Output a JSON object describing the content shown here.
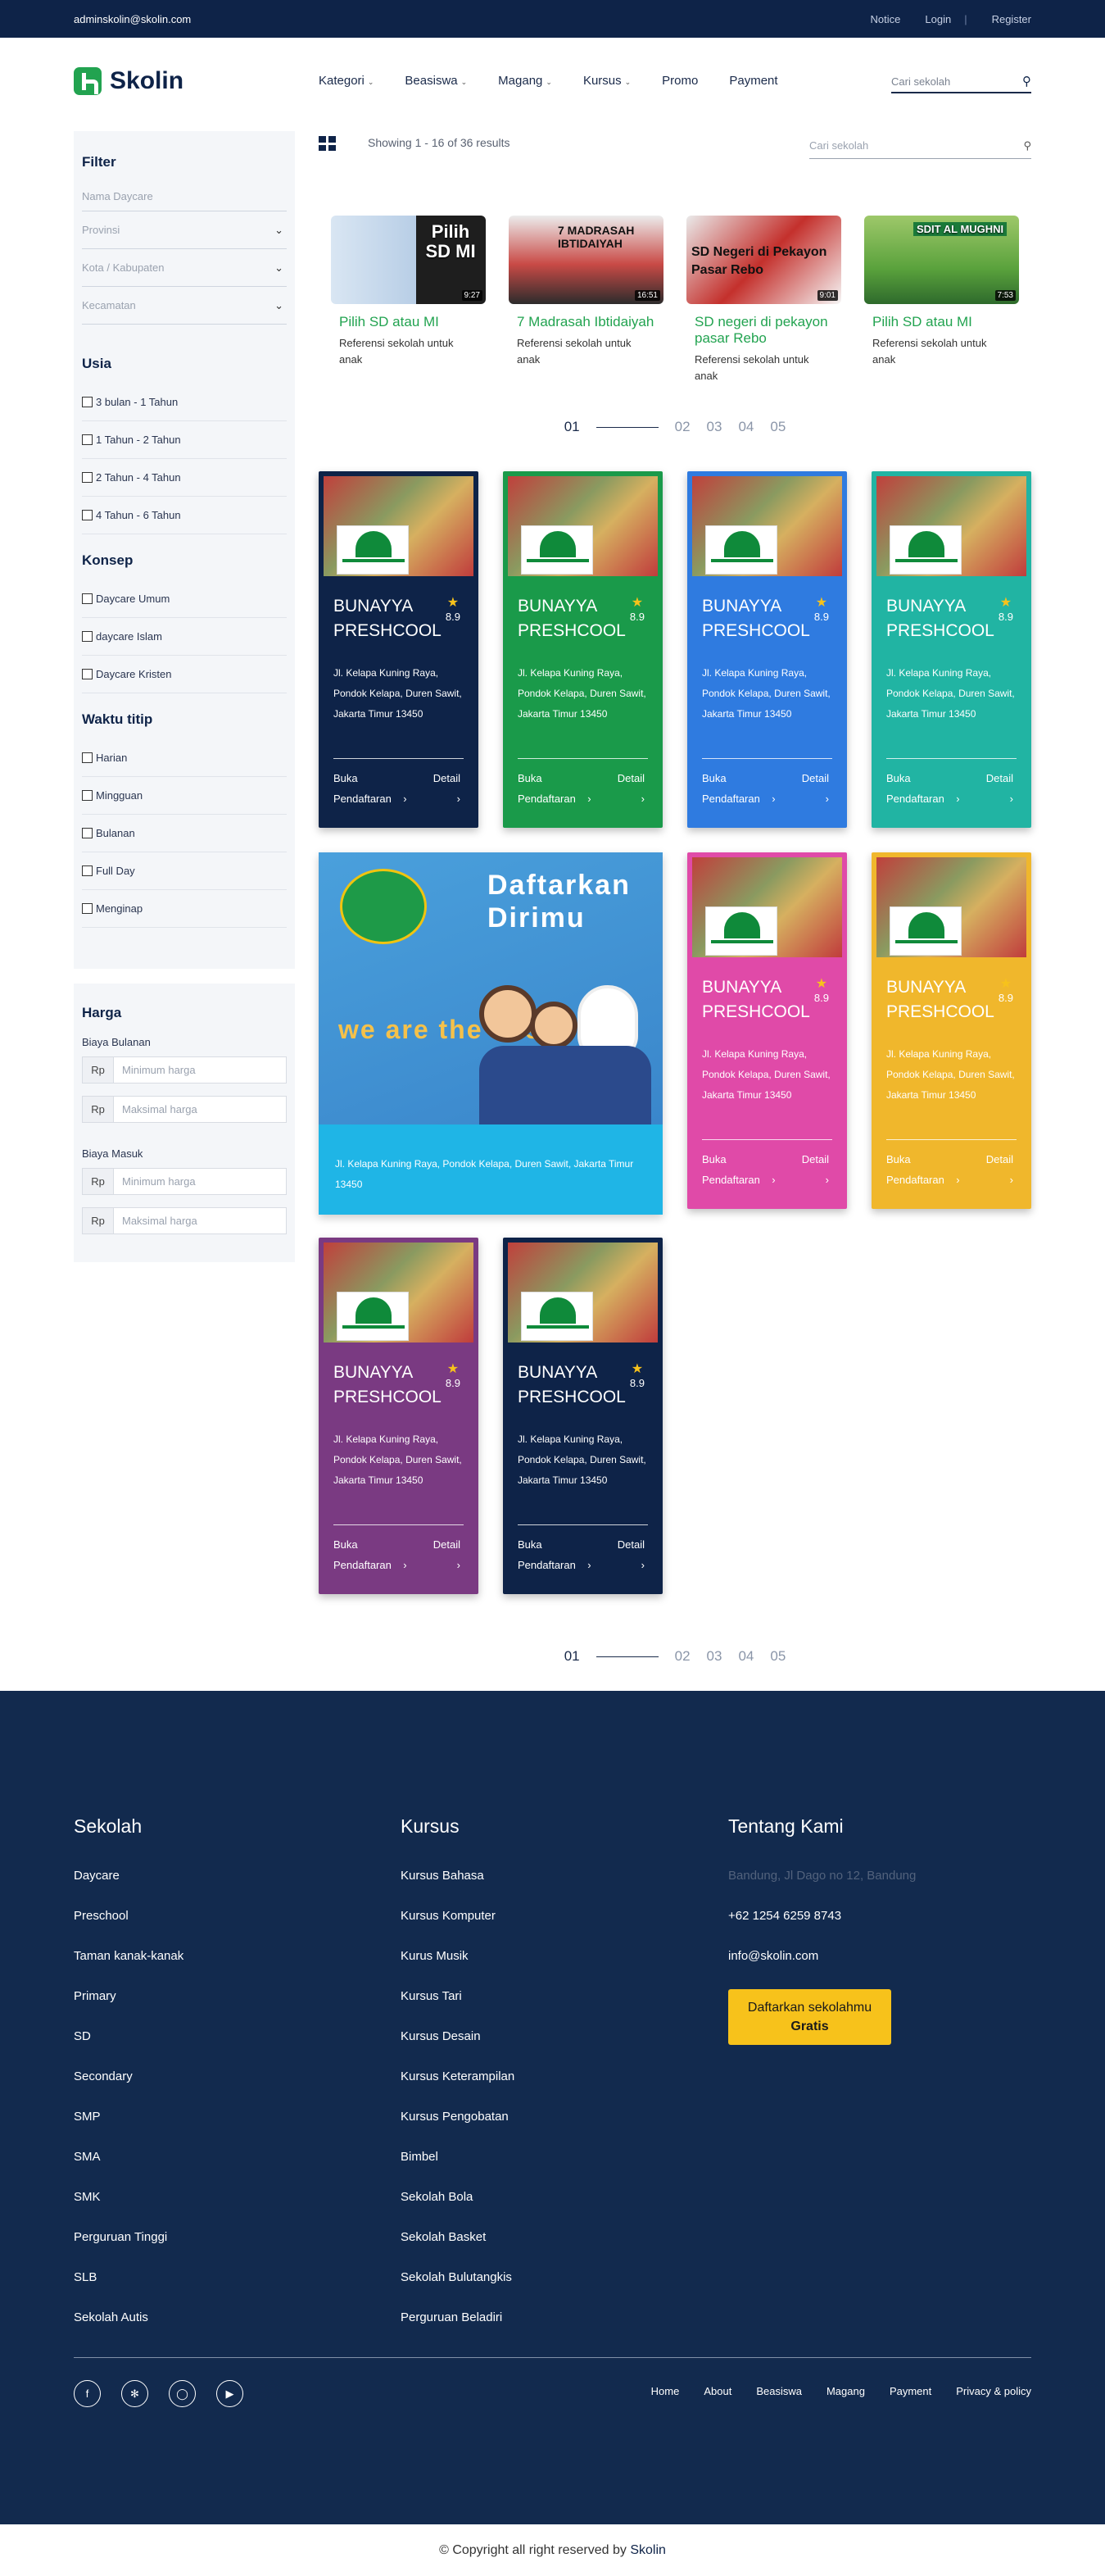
{
  "topbar": {
    "email": "adminskolin@skolin.com",
    "notice": "Notice",
    "login": "Login",
    "sep": "|",
    "register": "Register"
  },
  "brand": {
    "name": "Skolin",
    "color": "#22a350"
  },
  "nav": [
    {
      "label": "Kategori",
      "dropdown": true
    },
    {
      "label": "Beasiswa",
      "dropdown": true
    },
    {
      "label": "Magang",
      "dropdown": true
    },
    {
      "label": "Kursus",
      "dropdown": true
    },
    {
      "label": "Promo",
      "dropdown": false
    },
    {
      "label": "Payment",
      "dropdown": false
    }
  ],
  "header_search": {
    "placeholder": "Cari sekolah",
    "icon": "search-icon"
  },
  "filter": {
    "title": "Filter",
    "fields": [
      "Nama Daycare",
      "Provinsi",
      "Kota / Kabupaten",
      "Kecamatan"
    ],
    "usia": {
      "title": "Usia",
      "items": [
        "3 bulan - 1 Tahun",
        "1 Tahun - 2 Tahun",
        "2 Tahun - 4 Tahun",
        "4 Tahun - 6 Tahun"
      ]
    },
    "konsep": {
      "title": "Konsep",
      "items": [
        "Daycare Umum",
        "daycare Islam",
        "Daycare Kristen"
      ]
    },
    "waktu": {
      "title": "Waktu titip",
      "items": [
        "Harian",
        "Mingguan",
        "Bulanan",
        "Full Day",
        "Menginap"
      ]
    }
  },
  "harga": {
    "title": "Harga",
    "bulanan": "Biaya Bulanan",
    "masuk": "Biaya Masuk",
    "currency": "Rp",
    "min": "Minimum harga",
    "max": "Maksimal harga"
  },
  "results": {
    "text": "Showing 1 - 16 of 36 results",
    "search_placeholder": "Cari sekolah"
  },
  "videos": [
    {
      "title": "Pilih SD atau MI",
      "desc": "Referensi sekolah untuk anak",
      "thumb": "Pilih SD MI",
      "duration": "9:27"
    },
    {
      "title": "7 Madrasah Ibtidaiyah",
      "desc": "Referensi sekolah untuk anak",
      "thumb": "7 MADRASAH IBTIDAIYAH",
      "duration": "16:51"
    },
    {
      "title": "SD negeri di pekayon pasar Rebo",
      "desc": "Referensi sekolah untuk anak",
      "thumb": "SD Negeri di Pekayon Pasar Rebo",
      "duration": "9:01"
    },
    {
      "title": "Pilih SD atau MI",
      "desc": "Referensi sekolah untuk anak",
      "thumb": "SDIT AL MUGHNI",
      "duration": "7:53"
    }
  ],
  "pager": [
    "01",
    "02",
    "03",
    "04",
    "05"
  ],
  "school": {
    "name": "BUNAYYA PRESHCOOL",
    "rating": "8.9",
    "address": "Jl. Kelapa Kuning Raya, Pondok Kelapa, Duren Sawit, Jakarta Timur 13450",
    "buka": "Buka Pendaftaran",
    "detail": "Detail"
  },
  "card_colors": [
    "#0e2348",
    "#1a9a4a",
    "#2f7be0",
    "#21b4a3",
    "#e04aa8",
    "#f0b72c",
    "#7a3a82",
    "#0e2348"
  ],
  "promo": {
    "title": "Daftarkan Dirimu",
    "tagline": "we are the best",
    "address": "Jl. Kelapa Kuning Raya, Pondok Kelapa, Duren Sawit, Jakarta Timur 13450"
  },
  "footer": {
    "sekolah": {
      "title": "Sekolah",
      "items": [
        "Daycare",
        "Preschool",
        "Taman kanak-kanak",
        "Primary",
        "SD",
        "Secondary",
        "SMP",
        "SMA",
        "SMK",
        "Perguruan Tinggi",
        "SLB",
        "Sekolah Autis"
      ]
    },
    "kursus": {
      "title": "Kursus",
      "items": [
        "Kursus Bahasa",
        "Kursus Komputer",
        "Kurus Musik",
        "Kursus Tari",
        "Kursus Desain",
        "Kursus Keterampilan",
        "Kursus Pengobatan",
        "Bimbel",
        "Sekolah Bola",
        "Sekolah Basket",
        "Sekolah Bulutangkis",
        "Perguruan Beladiri"
      ]
    },
    "tentang": {
      "title": "Tentang Kami",
      "address": "Bandung, Jl Dago no 12, Bandung",
      "phone": "+62 1254 6259 8743",
      "email": "info@skolin.com",
      "btn1": "Daftarkan sekolahmu",
      "btn2": "Gratis"
    },
    "social": [
      "facebook-icon",
      "twitter-icon",
      "instagram-icon",
      "youtube-icon"
    ],
    "links": [
      "Home",
      "About",
      "Beasiswa",
      "Magang",
      "Payment",
      "Privacy & policy"
    ]
  },
  "copyright": {
    "text": "© Copyright all right reserved by",
    "brand": "Skolin"
  }
}
